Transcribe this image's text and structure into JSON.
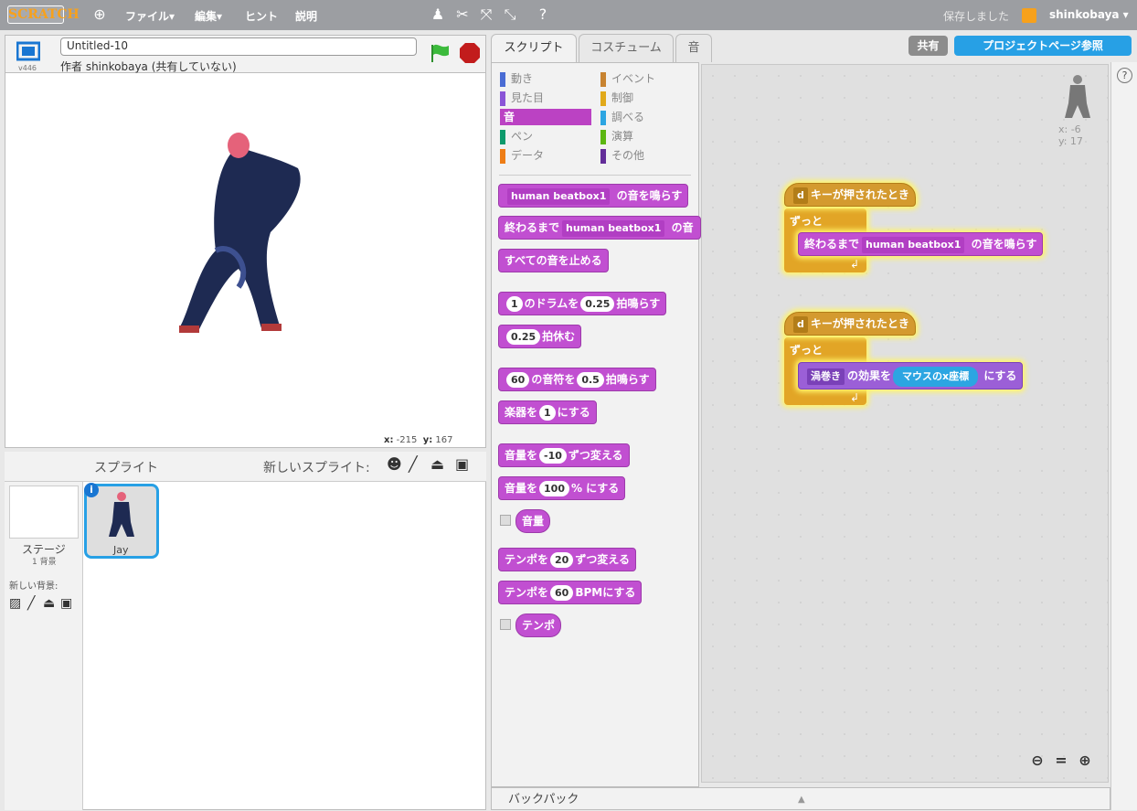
{
  "menubar": {
    "logo": "SCRATCH",
    "file": "ファイル▾",
    "edit": "編集▾",
    "tips": "ヒント",
    "about": "説明",
    "saved": "保存しました",
    "user": "shinkobaya ▾"
  },
  "stage": {
    "title": "Untitled-10",
    "byline": "作者 shinkobaya (共有していない)",
    "version": "v446",
    "coords_x_label": "x:",
    "coords_x": "-215",
    "coords_y_label": "y:",
    "coords_y": "167"
  },
  "sprites": {
    "header": "スプライト",
    "new_sprite": "新しいスプライト:",
    "stage_label": "ステージ",
    "stage_sub": "1 背景",
    "new_backdrop": "新しい背景:",
    "sprite_name": "Jay"
  },
  "tabs": {
    "scripts": "スクリプト",
    "costumes": "コスチューム",
    "sounds": "音"
  },
  "buttons": {
    "share": "共有",
    "project_page": "プロジェクトページ参照"
  },
  "categories": [
    {
      "label": "動き",
      "color": "#4a6cd4"
    },
    {
      "label": "イベント",
      "color": "#c88330"
    },
    {
      "label": "見た目",
      "color": "#8a55d7"
    },
    {
      "label": "制御",
      "color": "#e1a91a"
    },
    {
      "label": "音",
      "color": "#bb42c3"
    },
    {
      "label": "調べる",
      "color": "#2ca5e2"
    },
    {
      "label": "ペン",
      "color": "#0e9a6c"
    },
    {
      "label": "演算",
      "color": "#5cb712"
    },
    {
      "label": "データ",
      "color": "#ee7d16"
    },
    {
      "label": "その他",
      "color": "#632d99"
    }
  ],
  "palette": {
    "play_sound": "の音を鳴らす",
    "sound_name": "human beatbox1",
    "play_until": "終わるまで",
    "play_until_tail": "の音",
    "stop_all": "すべての音を止める",
    "drum_num": "1",
    "drum_mid": "のドラムを",
    "drum_beats": "0.25",
    "drum_tail": "拍鳴らす",
    "rest_beats": "0.25",
    "rest_tail": "拍休む",
    "note_num": "60",
    "note_mid": "の音符を",
    "note_beats": "0.5",
    "note_tail": "拍鳴らす",
    "inst_head": "楽器を",
    "inst_num": "1",
    "inst_tail": "にする",
    "vol_change_head": "音量を",
    "vol_change_num": "-10",
    "vol_change_tail": "ずつ変える",
    "vol_set_head": "音量を",
    "vol_set_num": "100",
    "vol_set_tail": "% にする",
    "vol_reporter": "音量",
    "tempo_change_head": "テンポを",
    "tempo_change_num": "20",
    "tempo_change_tail": "ずつ変える",
    "tempo_set_head": "テンポを",
    "tempo_set_num": "60",
    "tempo_set_tail": "BPMにする",
    "tempo_reporter": "テンポ"
  },
  "scripts": {
    "key": "d",
    "when_key": "キーが押されたとき",
    "forever": "ずっと",
    "play_until": "終わるまで",
    "sound_name": "human beatbox1",
    "play_tail": "の音を鳴らす",
    "effect": "渦巻き",
    "effect_mid": "の効果を",
    "mouse_x": "マウスのx座標",
    "effect_tail": "にする",
    "sprite_x": "x: -6",
    "sprite_y": "y: 17"
  },
  "backpack": "バックパック"
}
